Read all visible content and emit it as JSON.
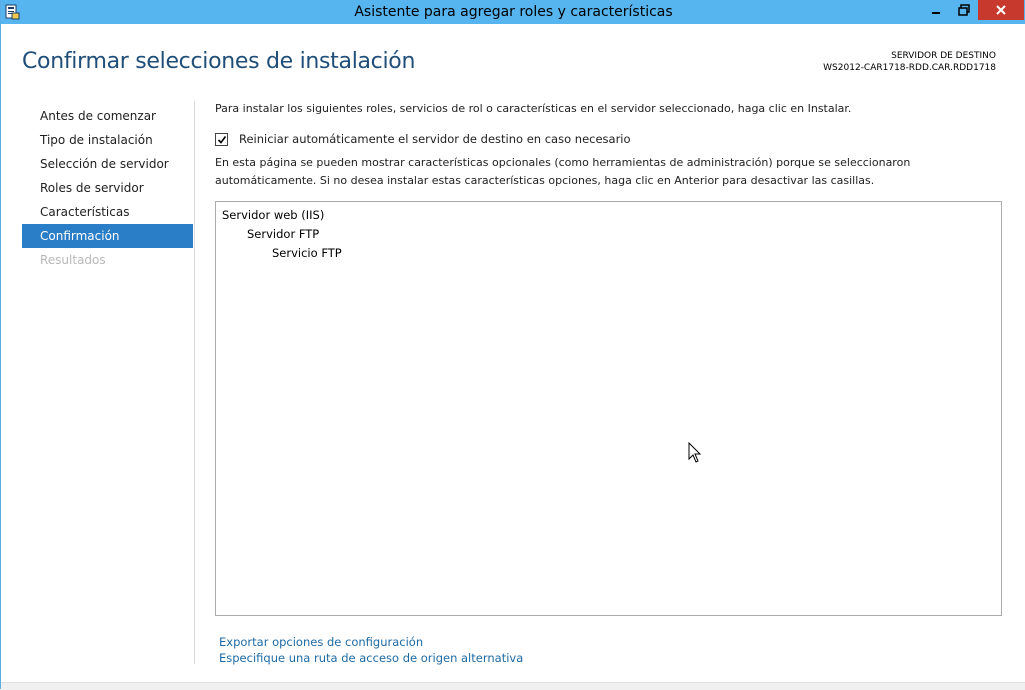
{
  "window": {
    "title": "Asistente para agregar roles y características",
    "icons": [
      "server-wizard-icon",
      "minimize-icon",
      "maximize-icon",
      "close-icon"
    ]
  },
  "header": {
    "page_title": "Confirmar selecciones de instalación",
    "destination_label": "SERVIDOR DE DESTINO",
    "destination_server": "WS2012-CAR1718-RDD.CAR.RDD1718"
  },
  "nav": {
    "items": [
      {
        "label": "Antes de comenzar",
        "state": "normal"
      },
      {
        "label": "Tipo de instalación",
        "state": "normal"
      },
      {
        "label": "Selección de servidor",
        "state": "normal"
      },
      {
        "label": "Roles de servidor",
        "state": "normal"
      },
      {
        "label": "Características",
        "state": "normal"
      },
      {
        "label": "Confirmación",
        "state": "active"
      },
      {
        "label": "Resultados",
        "state": "disabled"
      }
    ]
  },
  "main": {
    "intro": "Para instalar los siguientes roles, servicios de rol o características en el servidor seleccionado, haga clic en Instalar.",
    "restart_checkbox": {
      "label": "Reiniciar automáticamente el servidor de destino en caso necesario",
      "checked": true
    },
    "note": "En esta página se pueden mostrar características opcionales (como herramientas de administración) porque se seleccionaron automáticamente. Si no desea instalar estas características opciones, haga clic en Anterior para desactivar las casillas.",
    "selection_list": [
      {
        "label": "Servidor web (IIS)",
        "level": 0
      },
      {
        "label": "Servidor FTP",
        "level": 1
      },
      {
        "label": "Servicio FTP",
        "level": 2
      }
    ],
    "links": {
      "export": "Exportar opciones de configuración",
      "alt_source": "Especifique una ruta de acceso de origen alternativa"
    }
  },
  "colors": {
    "titlebar": "#56b4ef",
    "close_button": "#c7392d",
    "nav_active": "#2a7dc7",
    "page_title": "#1f4e79",
    "link": "#1d6aa3"
  }
}
